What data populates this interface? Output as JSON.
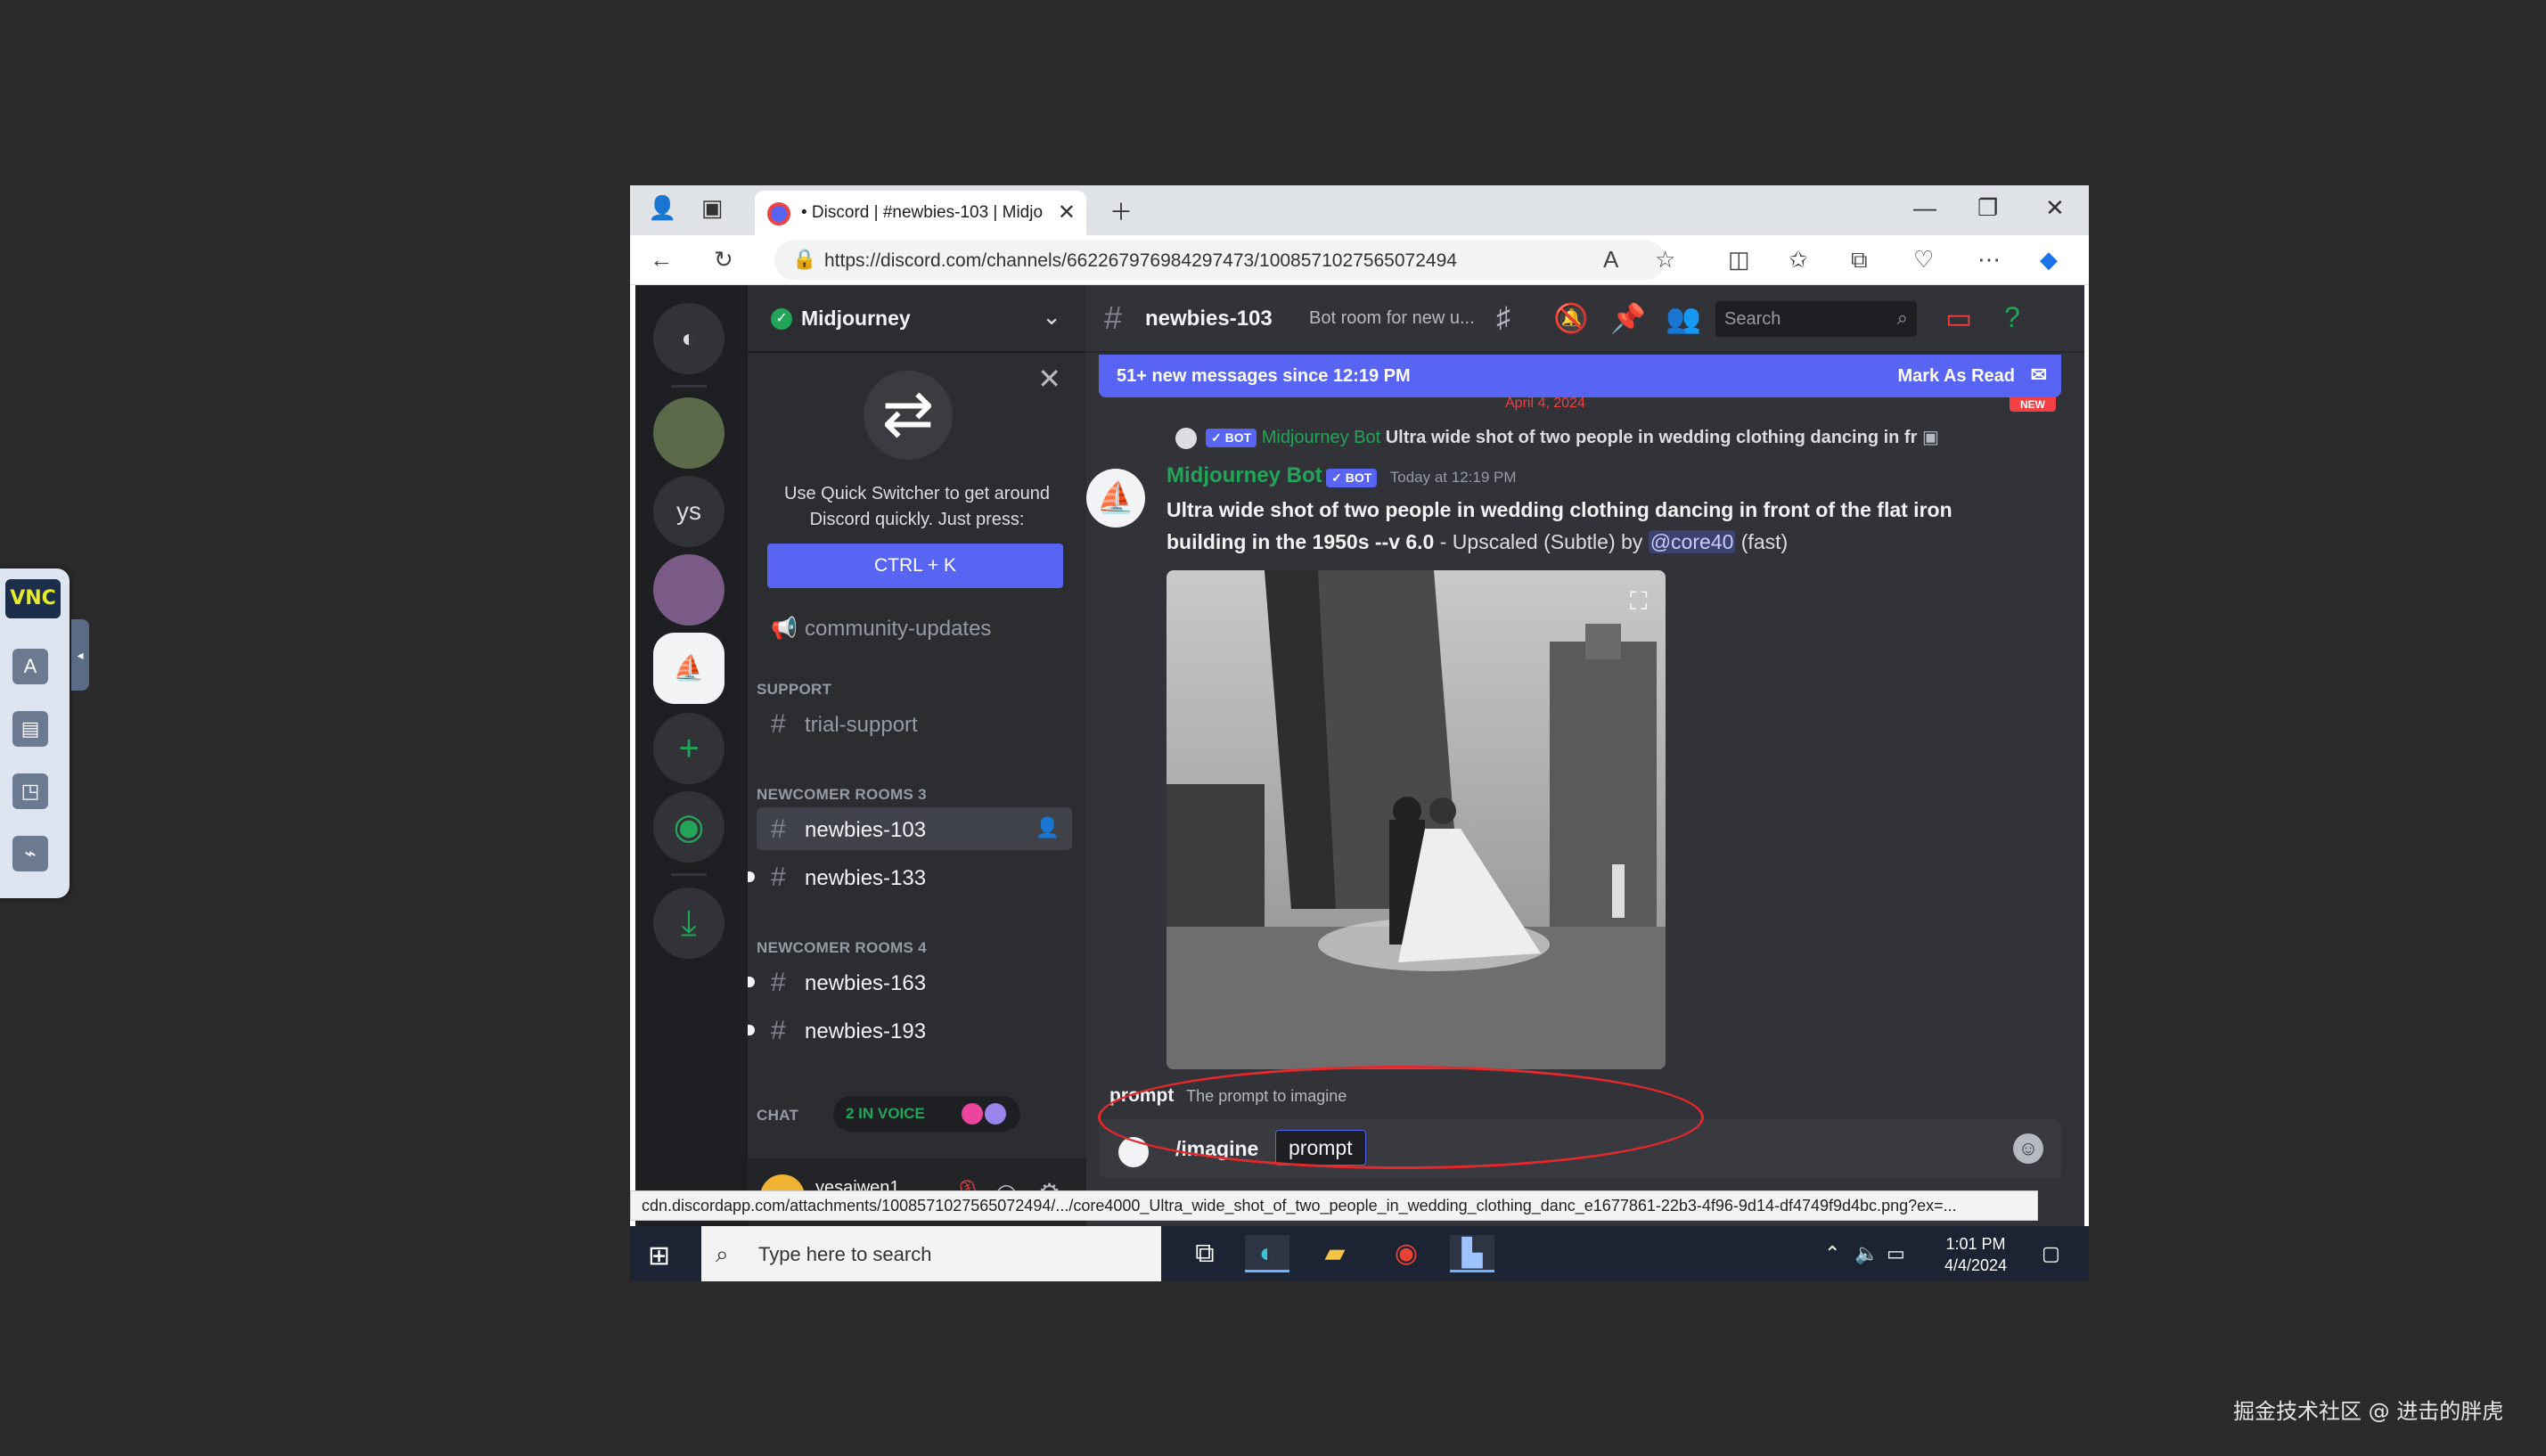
{
  "novnc": {
    "logo": "VNC"
  },
  "browser": {
    "tab_title": "• Discord | #newbies-103 | Midjo",
    "url": "https://discord.com/channels/662267976984297473/1008571027565072494",
    "status_url": "cdn.discordapp.com/attachments/1008571027565072494/.../core4000_Ultra_wide_shot_of_two_people_in_wedding_clothing_danc_e1677861-22b3-4f96-9d14-df4749f9d4bc.png?ex=..."
  },
  "servers": [
    {
      "label": ""
    },
    {
      "label": "ys"
    }
  ],
  "guild": {
    "name": "Midjourney"
  },
  "quick_switcher": {
    "desc": "Use Quick Switcher to get around Discord quickly. Just press:",
    "button": "CTRL + K"
  },
  "channels": {
    "announce": "community-updates",
    "cat_support": "SUPPORT",
    "trial": "trial-support",
    "cat_newcomer3": "NEWCOMER ROOMS 3",
    "n103": "newbies-103",
    "n133": "newbies-133",
    "cat_newcomer4": "NEWCOMER ROOMS 4",
    "n163": "newbies-163",
    "n193": "newbies-193",
    "cat_chat": "CHAT",
    "voice": "2 IN VOICE"
  },
  "user": {
    "name": "yesaiwen1"
  },
  "chat": {
    "channel": "newbies-103",
    "topic": "Bot room for new u...",
    "search_placeholder": "Search",
    "new_messages": "51+ new messages since 12:19 PM",
    "mark_read": "Mark As Read",
    "date": "April 4, 2024",
    "new_tag": "NEW",
    "reply_author": "Midjourney Bot",
    "reply_text": "Ultra wide shot of two people in wedding clothing dancing in fr",
    "bot_tag": "BOT",
    "author": "Midjourney Bot",
    "timestamp": "Today at 12:19 PM",
    "prompt_bold": "Ultra wide shot of two people in wedding clothing dancing in front of the flat iron building in the 1950s --v 6.0",
    "suffix": " - Upscaled (Subtle) by ",
    "mention": "@core40",
    "fast": " (fast)",
    "hint_name": "prompt",
    "hint_desc": "The prompt to imagine",
    "command": "/imagine",
    "option": "prompt"
  },
  "taskbar": {
    "search": "Type here to search",
    "time": "1:01 PM",
    "date": "4/4/2024"
  },
  "watermark": "掘金技术社区 @ 进击的胖虎"
}
